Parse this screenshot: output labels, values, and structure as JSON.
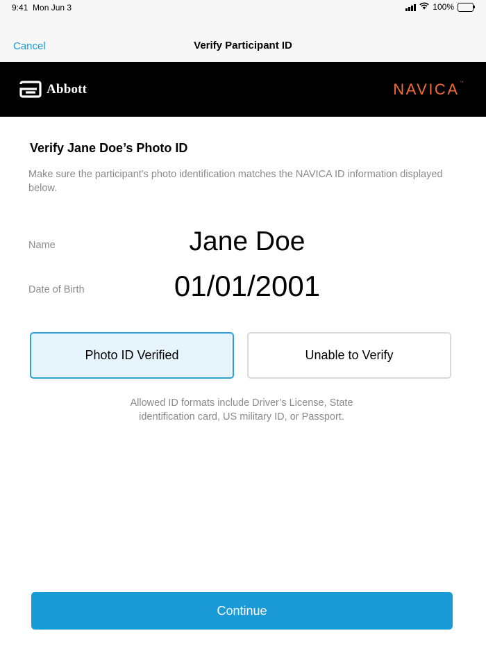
{
  "status_bar": {
    "time": "9:41",
    "date": "Mon Jun 3",
    "battery_percent": "100%",
    "icons": [
      "cellular-signal-icon",
      "wifi-icon",
      "battery-icon"
    ]
  },
  "navbar": {
    "cancel_label": "Cancel",
    "title": "Verify Participant ID"
  },
  "brand_bar": {
    "left_logo": "Abbott",
    "right_logo": "NAVICA",
    "right_logo_mark": "™"
  },
  "main": {
    "heading": "Verify Jane Doe’s Photo ID",
    "instructions": "Make sure the participant's photo identification matches the NAVICA ID information displayed below.",
    "fields": [
      {
        "label": "Name",
        "value": "Jane Doe"
      },
      {
        "label": "Date of Birth",
        "value": "01/01/2001"
      }
    ],
    "buttons": {
      "verified_label": "Photo ID Verified",
      "verified_selected": true,
      "unable_label": "Unable to Verify"
    },
    "allowed_formats_line1": "Allowed ID formats include Driver’s License, State",
    "allowed_formats_line2": "identification card, US military ID, or Passport."
  },
  "footer": {
    "continue_label": "Continue"
  },
  "colors": {
    "accent": "#1a9bd7",
    "brand_bar": "#000000",
    "navica_orange": "#f26b38",
    "selected_fill": "#e6f4fb",
    "muted_text": "#8a8a8e"
  }
}
